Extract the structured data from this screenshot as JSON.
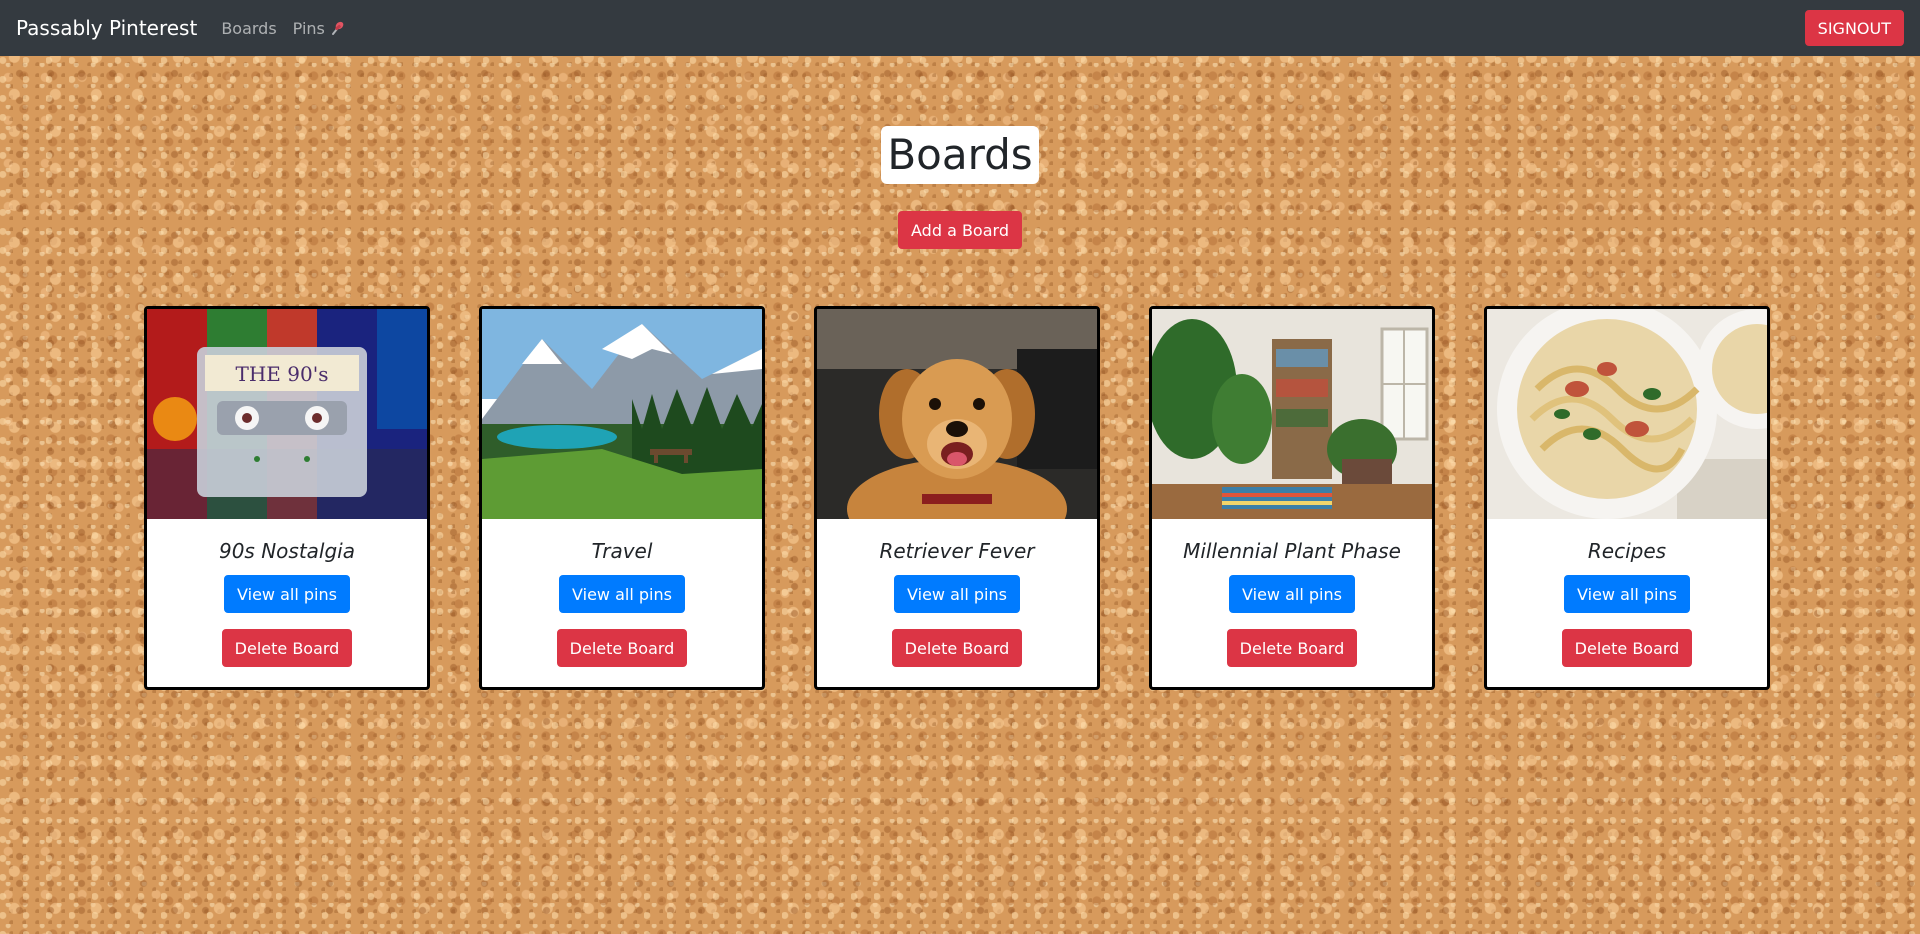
{
  "navbar": {
    "brand": "Passably Pinterest",
    "links": [
      {
        "label": "Boards"
      },
      {
        "label": "Pins",
        "icon": "pushpin-icon"
      }
    ],
    "signout_label": "SIGNOUT"
  },
  "main": {
    "title": "Boards",
    "add_board_label": "Add a Board"
  },
  "boards": [
    {
      "name": "90s Nostalgia",
      "image": "cassette-tape-photo",
      "view_label": "View all pins",
      "delete_label": "Delete Board"
    },
    {
      "name": "Travel",
      "image": "mountain-lake-photo",
      "view_label": "View all pins",
      "delete_label": "Delete Board"
    },
    {
      "name": "Retriever Fever",
      "image": "golden-retriever-photo",
      "view_label": "View all pins",
      "delete_label": "Delete Board"
    },
    {
      "name": "Millennial Plant Phase",
      "image": "houseplants-room-photo",
      "view_label": "View all pins",
      "delete_label": "Delete Board"
    },
    {
      "name": "Recipes",
      "image": "pasta-bowl-photo",
      "view_label": "View all pins",
      "delete_label": "Delete Board"
    }
  ],
  "colors": {
    "navbar_bg": "#343a40",
    "danger": "#dc3545",
    "primary": "#007bff",
    "cork": "#d79a5c"
  }
}
